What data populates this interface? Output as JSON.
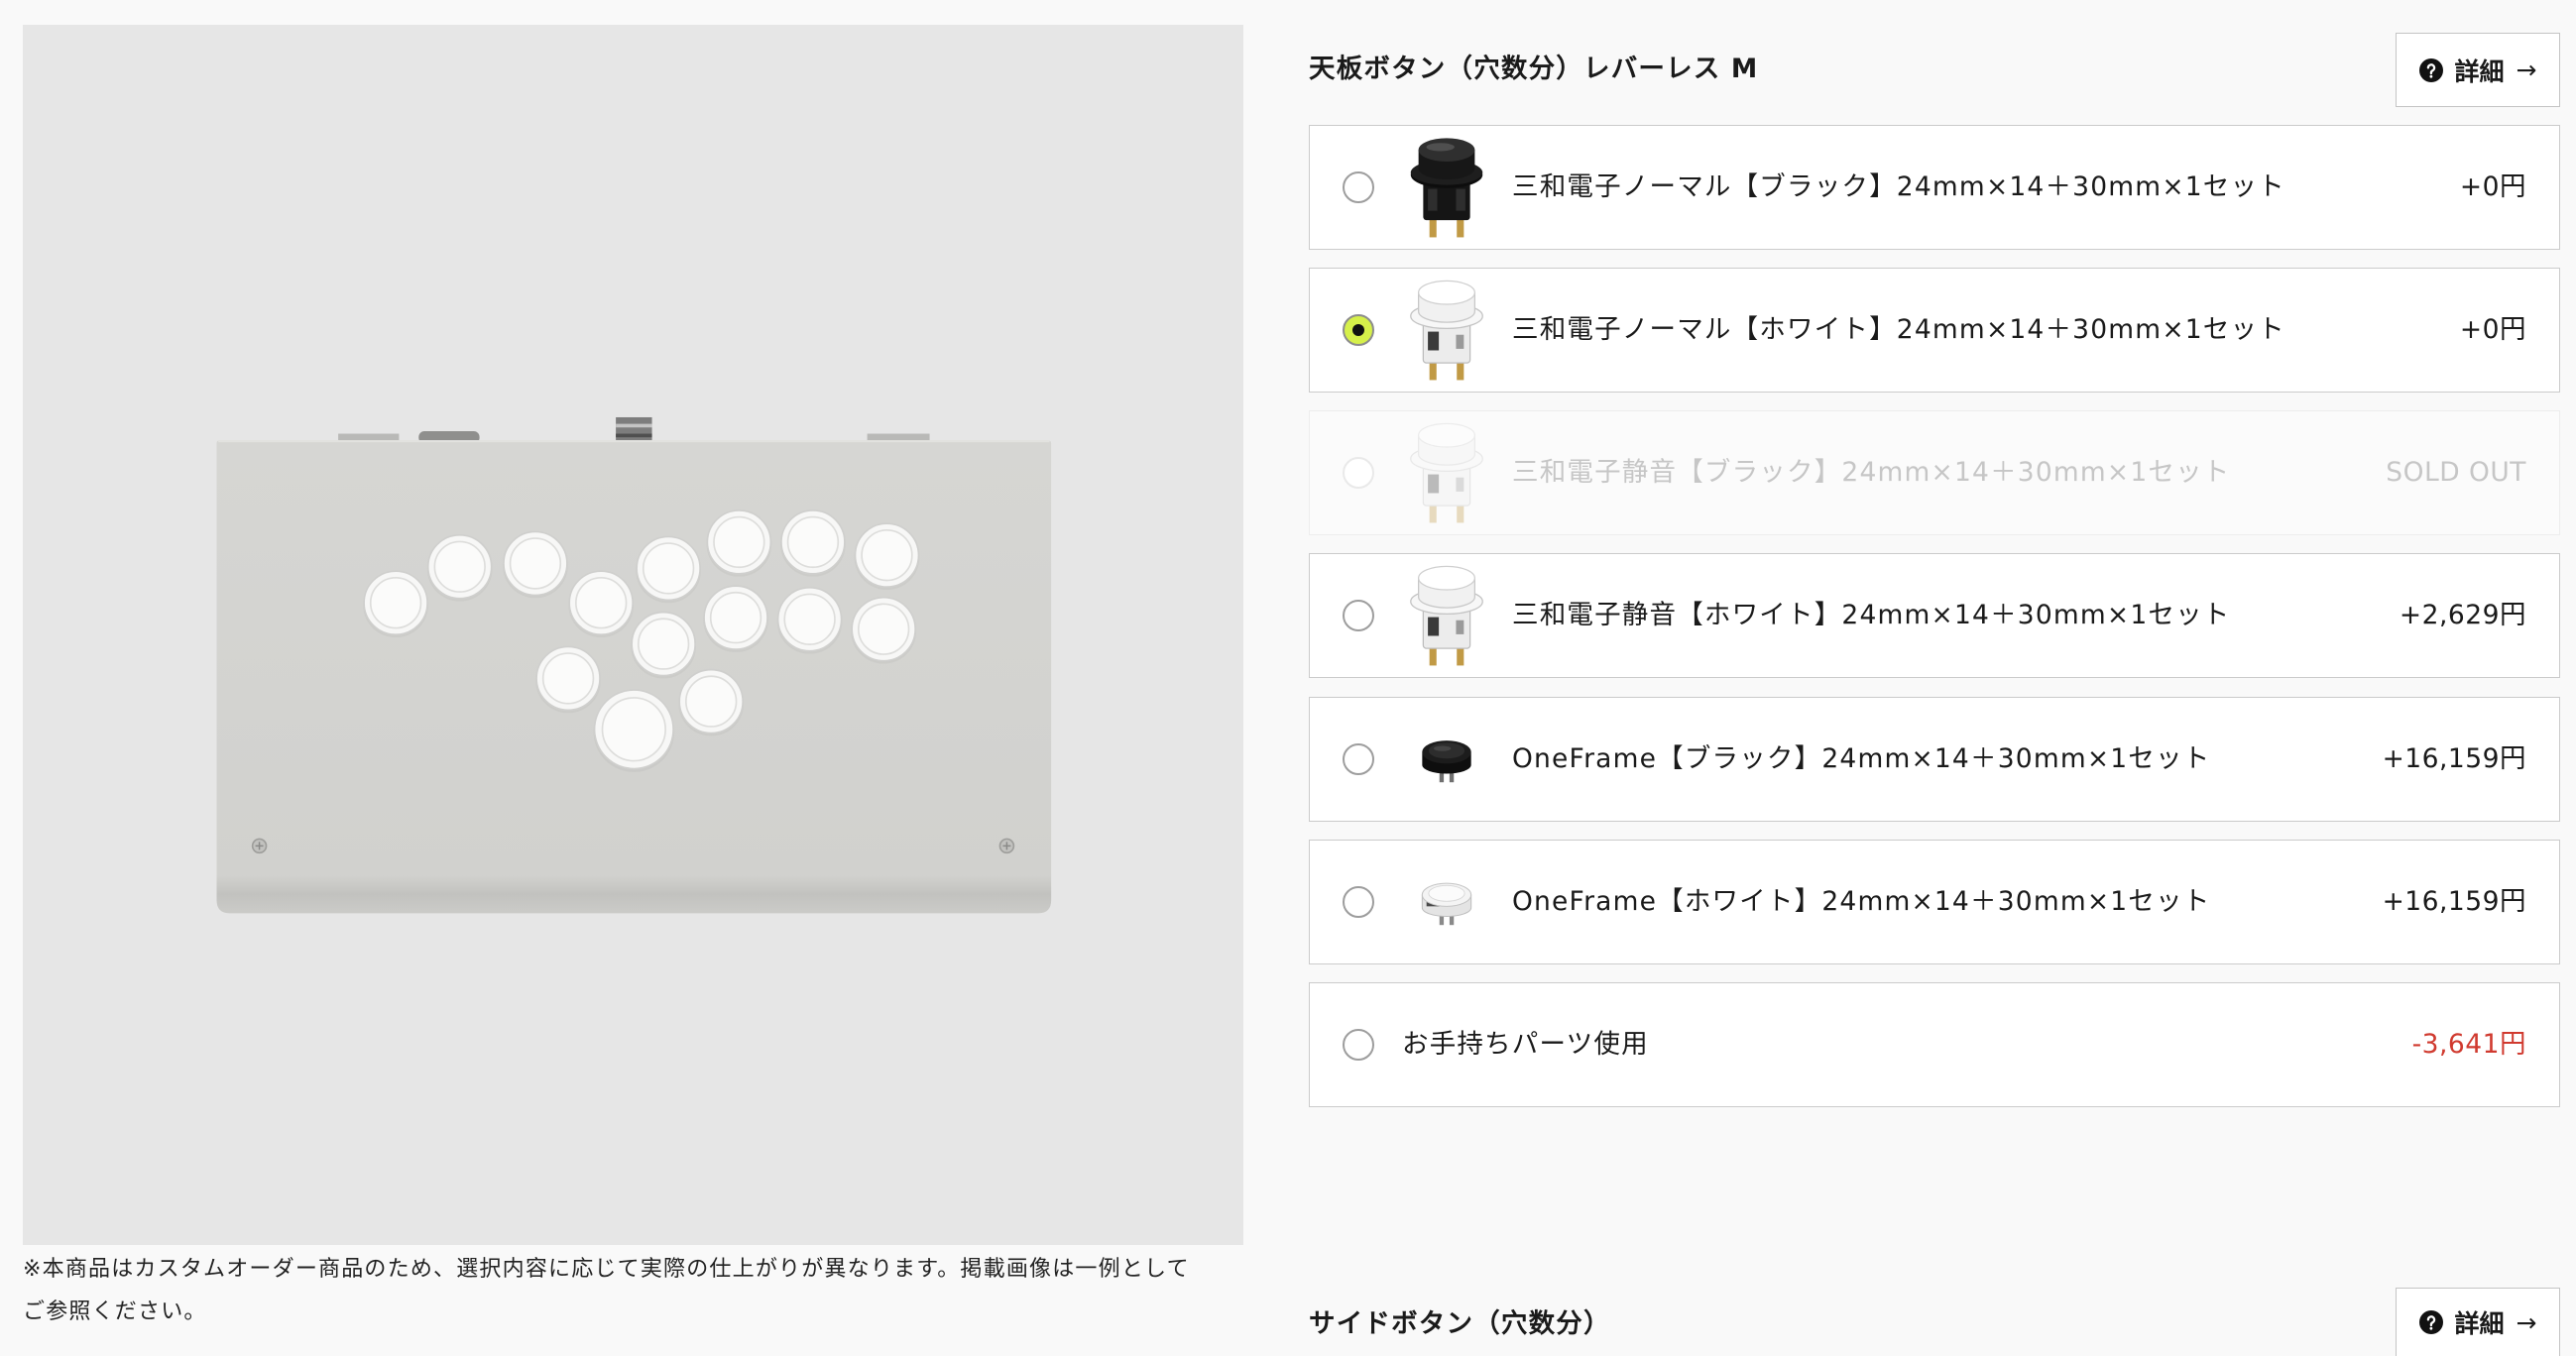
{
  "product_image": {
    "icon": "leverless-controller"
  },
  "note": {
    "lines": [
      "※本商品はカスタムオーダー商品のため、選択内容に応じて実際の仕上がりが異なります。掲載画像は一例として",
      "ご参照ください。"
    ]
  },
  "sections": [
    {
      "title": "天板ボタン（穴数分）レバーレス M",
      "detail_button": {
        "icon": "question-circle",
        "label": "詳細",
        "arrow": "→"
      },
      "options": [
        {
          "icon": "sanwa-black-button",
          "label": "三和電子ノーマル【ブラック】24mm×14＋30mm×1セット",
          "price": "+0円",
          "selected": false,
          "disabled": false
        },
        {
          "icon": "sanwa-white-button",
          "label": "三和電子ノーマル【ホワイト】24mm×14＋30mm×1セット",
          "price": "+0円",
          "selected": true,
          "disabled": false
        },
        {
          "icon": "sanwa-black-silent-button",
          "label": "三和電子静音【ブラック】24mm×14＋30mm×1セット",
          "price": "SOLD OUT",
          "selected": false,
          "disabled": true
        },
        {
          "icon": "sanwa-white-silent-button",
          "label": "三和電子静音【ホワイト】24mm×14＋30mm×1セット",
          "price": "+2,629円",
          "selected": false,
          "disabled": false
        },
        {
          "icon": "oneframe-black-button",
          "label": "OneFrame【ブラック】24mm×14＋30mm×1セット",
          "price": "+16,159円",
          "selected": false,
          "disabled": false
        },
        {
          "icon": "oneframe-white-button",
          "label": "OneFrame【ホワイト】24mm×14＋30mm×1セット",
          "price": "+16,159円",
          "selected": false,
          "disabled": false
        },
        {
          "label": "お手持ちパーツ使用",
          "price": "-3,641円",
          "price_color": "#d03a2f",
          "selected": false,
          "disabled": false
        }
      ]
    },
    {
      "title": "サイドボタン（穴数分）",
      "detail_button": {
        "icon": "question-circle",
        "label": "詳細",
        "arrow": "→"
      }
    }
  ],
  "colors": {
    "page_background": "#f9f9f9",
    "image_background": "#e6e6e6",
    "accent": "#d6f04a",
    "negative_price": "#d03a2f",
    "disabled_text": "#c6c6c6",
    "text": "#1a1a1a"
  }
}
